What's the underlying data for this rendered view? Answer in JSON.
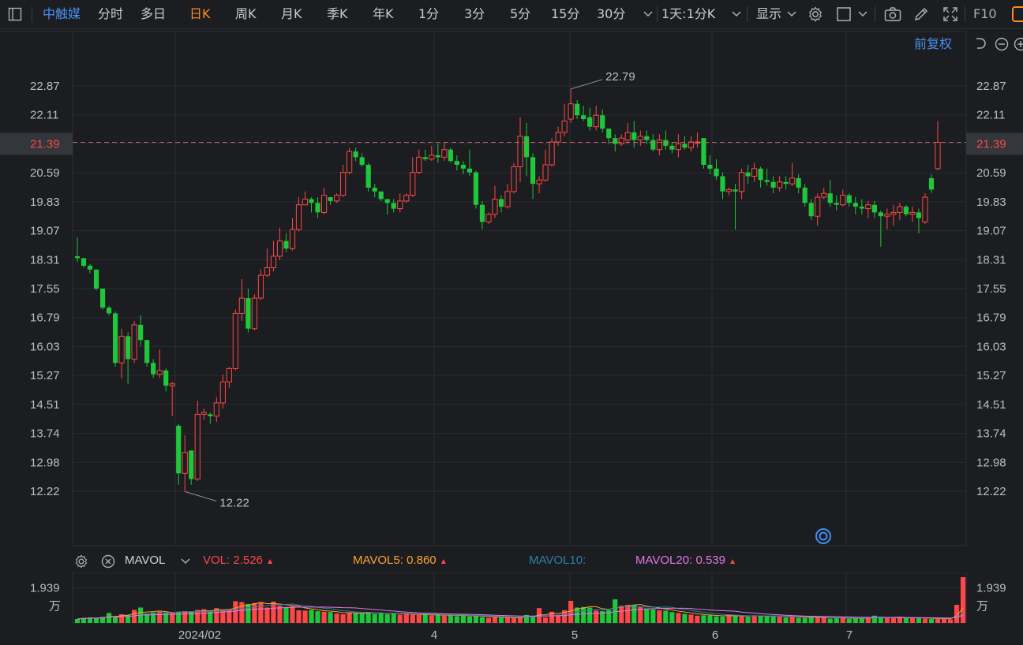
{
  "toolbar": {
    "stock_name": "中触媒",
    "periods": [
      "分时",
      "多日",
      "日K",
      "周K",
      "月K",
      "季K",
      "年K",
      "1分",
      "3分",
      "5分",
      "15分",
      "30分"
    ],
    "active_period": "日K",
    "combo_label": "1天:1分K",
    "display_label": "显示",
    "f10_label": "F10",
    "icons": [
      "sidebar-toggle-icon",
      "chevron-down-icon",
      "gear-icon",
      "square-icon",
      "camera-icon",
      "pencil-icon",
      "fullscreen-icon"
    ]
  },
  "sub_toolbar": {
    "adjust_label": "前复权"
  },
  "colors": {
    "up": "#ff4747",
    "down": "#1fc73a",
    "ma5": "#ffa133",
    "ma10": "#2f7fa8",
    "ma20": "#e278e6",
    "price_line": "#c46565",
    "accent": "#4a90f0"
  },
  "chart_data": [
    {
      "type": "candlestick",
      "y_ticks": [
        "22.87",
        "22.11",
        "21.39",
        "20.59",
        "19.83",
        "19.07",
        "18.31",
        "17.55",
        "16.79",
        "16.03",
        "15.27",
        "14.51",
        "13.74",
        "12.98",
        "12.22"
      ],
      "current_price": "21.39",
      "high_label": "22.79",
      "low_label": "12.22",
      "ylim": [
        11.5,
        23.6
      ],
      "candles": [
        [
          18.4,
          18.35,
          18.9,
          18.25
        ],
        [
          18.35,
          18.15,
          18.35,
          18.1
        ],
        [
          18.15,
          18.05,
          18.2,
          17.95
        ],
        [
          18.05,
          17.55,
          18.05,
          17.5
        ],
        [
          17.55,
          17.05,
          17.55,
          17.0
        ],
        [
          17.05,
          16.9,
          17.1,
          16.85
        ],
        [
          16.9,
          15.6,
          16.95,
          15.5
        ],
        [
          15.6,
          16.3,
          16.5,
          15.2
        ],
        [
          16.3,
          15.7,
          16.4,
          15.05
        ],
        [
          15.7,
          16.6,
          16.7,
          15.6
        ],
        [
          16.6,
          16.2,
          16.85,
          16.05
        ],
        [
          16.2,
          15.6,
          16.2,
          15.5
        ],
        [
          15.6,
          15.3,
          15.7,
          15.2
        ],
        [
          15.3,
          15.4,
          15.95,
          15.2
        ],
        [
          15.4,
          15.0,
          15.45,
          14.85
        ],
        [
          15.0,
          15.05,
          15.1,
          14.2
        ],
        [
          13.95,
          12.7,
          14.0,
          12.4
        ],
        [
          12.7,
          13.25,
          13.7,
          12.22
        ],
        [
          13.3,
          12.55,
          13.3,
          12.4
        ],
        [
          12.55,
          14.25,
          14.6,
          12.5
        ],
        [
          14.25,
          14.3,
          14.4,
          14.1
        ],
        [
          14.25,
          14.2,
          14.3,
          14.0
        ],
        [
          14.2,
          14.55,
          14.7,
          14.05
        ],
        [
          14.55,
          15.1,
          15.3,
          14.4
        ],
        [
          15.1,
          15.45,
          15.5,
          14.95
        ],
        [
          15.45,
          16.9,
          17.0,
          15.4
        ],
        [
          16.9,
          17.3,
          17.8,
          16.7
        ],
        [
          17.3,
          16.5,
          17.55,
          16.4
        ],
        [
          16.5,
          17.3,
          17.4,
          16.45
        ],
        [
          17.3,
          17.9,
          18.05,
          17.25
        ],
        [
          17.9,
          18.1,
          18.6,
          17.85
        ],
        [
          18.1,
          18.4,
          18.8,
          18.0
        ],
        [
          18.4,
          18.8,
          19.15,
          18.3
        ],
        [
          18.8,
          18.6,
          19.0,
          18.5
        ],
        [
          18.6,
          19.1,
          19.4,
          18.55
        ],
        [
          19.1,
          19.75,
          19.95,
          19.05
        ],
        [
          19.75,
          19.9,
          20.1,
          19.75
        ],
        [
          19.9,
          19.8,
          19.95,
          19.55
        ],
        [
          19.8,
          19.55,
          19.95,
          19.4
        ],
        [
          19.55,
          20.0,
          20.2,
          19.5
        ],
        [
          19.95,
          19.85,
          19.95,
          19.75
        ],
        [
          19.85,
          20.0,
          20.05,
          19.8
        ],
        [
          20.0,
          20.6,
          20.8,
          19.95
        ],
        [
          20.6,
          21.15,
          21.25,
          20.55
        ],
        [
          21.15,
          21.0,
          21.25,
          20.9
        ],
        [
          21.0,
          20.8,
          21.1,
          20.75
        ],
        [
          20.8,
          20.2,
          20.85,
          20.1
        ],
        [
          20.2,
          20.1,
          20.3,
          19.95
        ],
        [
          20.1,
          19.9,
          20.1,
          19.85
        ],
        [
          19.9,
          19.8,
          19.9,
          19.5
        ],
        [
          19.8,
          19.65,
          19.9,
          19.55
        ],
        [
          19.65,
          19.85,
          20.05,
          19.55
        ],
        [
          19.85,
          20.0,
          20.05,
          19.8
        ],
        [
          20.0,
          20.6,
          21.0,
          19.95
        ],
        [
          20.6,
          21.0,
          21.2,
          20.55
        ],
        [
          21.0,
          20.95,
          21.2,
          20.9
        ],
        [
          20.95,
          21.05,
          21.3,
          20.9
        ],
        [
          21.05,
          21.0,
          21.35,
          20.85
        ],
        [
          21.0,
          21.2,
          21.4,
          20.9
        ],
        [
          21.2,
          20.9,
          21.25,
          20.85
        ],
        [
          20.9,
          20.8,
          21.05,
          20.65
        ],
        [
          20.8,
          20.7,
          20.9,
          20.55
        ],
        [
          20.7,
          20.6,
          21.2,
          20.5
        ],
        [
          20.6,
          19.75,
          20.65,
          19.65
        ],
        [
          19.75,
          19.3,
          19.85,
          19.1
        ],
        [
          19.3,
          19.5,
          19.55,
          19.25
        ],
        [
          19.5,
          19.9,
          20.25,
          19.4
        ],
        [
          19.9,
          19.7,
          20.0,
          19.55
        ],
        [
          19.7,
          20.1,
          20.3,
          19.65
        ],
        [
          20.1,
          20.75,
          20.85,
          20.05
        ],
        [
          20.75,
          21.55,
          22.05,
          20.35
        ],
        [
          21.55,
          21.0,
          21.9,
          20.5
        ],
        [
          21.0,
          20.3,
          21.1,
          19.9
        ],
        [
          20.3,
          20.4,
          20.5,
          20.05
        ],
        [
          20.4,
          20.8,
          21.2,
          20.35
        ],
        [
          20.8,
          21.4,
          21.5,
          20.75
        ],
        [
          21.4,
          21.65,
          21.8,
          21.3
        ],
        [
          21.65,
          21.95,
          22.4,
          21.55
        ],
        [
          22.0,
          22.4,
          22.79,
          21.9
        ],
        [
          22.4,
          22.1,
          22.5,
          22.0
        ],
        [
          22.1,
          22.0,
          22.35,
          21.95
        ],
        [
          22.05,
          21.8,
          22.3,
          21.7
        ],
        [
          21.8,
          22.1,
          22.35,
          21.7
        ],
        [
          22.1,
          21.75,
          22.25,
          21.65
        ],
        [
          21.75,
          21.5,
          21.75,
          21.35
        ],
        [
          21.5,
          21.35,
          21.6,
          21.15
        ],
        [
          21.35,
          21.5,
          21.6,
          21.3
        ],
        [
          21.45,
          21.65,
          21.9,
          21.35
        ],
        [
          21.65,
          21.45,
          21.95,
          21.25
        ],
        [
          21.45,
          21.55,
          21.7,
          21.3
        ],
        [
          21.55,
          21.45,
          21.7,
          21.35
        ],
        [
          21.45,
          21.2,
          21.6,
          21.15
        ],
        [
          21.2,
          21.45,
          21.6,
          21.05
        ],
        [
          21.45,
          21.3,
          21.7,
          21.2
        ],
        [
          21.3,
          21.2,
          21.4,
          21.1
        ],
        [
          21.2,
          21.35,
          21.6,
          21.0
        ],
        [
          21.35,
          21.25,
          21.55,
          21.2
        ],
        [
          21.25,
          21.4,
          21.55,
          21.15
        ],
        [
          21.4,
          21.4,
          21.65,
          21.25
        ],
        [
          21.5,
          20.8,
          21.5,
          20.7
        ],
        [
          20.8,
          20.7,
          21.05,
          20.55
        ],
        [
          20.7,
          20.5,
          20.95,
          20.4
        ],
        [
          20.5,
          20.1,
          20.6,
          19.9
        ],
        [
          20.1,
          20.15,
          20.2,
          20.0
        ],
        [
          20.15,
          20.1,
          20.3,
          19.1
        ],
        [
          20.1,
          20.6,
          20.7,
          19.9
        ],
        [
          20.6,
          20.5,
          20.8,
          20.3
        ],
        [
          20.5,
          20.7,
          20.85,
          20.35
        ],
        [
          20.7,
          20.4,
          20.75,
          20.2
        ],
        [
          20.4,
          20.35,
          20.7,
          20.25
        ],
        [
          20.35,
          20.2,
          20.5,
          20.05
        ],
        [
          20.2,
          20.35,
          20.5,
          20.1
        ],
        [
          20.35,
          20.3,
          20.5,
          20.15
        ],
        [
          20.3,
          20.45,
          20.85,
          20.25
        ],
        [
          20.45,
          20.2,
          20.55,
          20.05
        ],
        [
          20.2,
          19.8,
          20.3,
          19.7
        ],
        [
          19.8,
          19.45,
          19.9,
          19.35
        ],
        [
          19.45,
          19.95,
          20.05,
          19.2
        ],
        [
          19.95,
          20.05,
          20.2,
          19.9
        ],
        [
          20.05,
          19.8,
          20.4,
          19.7
        ],
        [
          19.8,
          19.75,
          20.0,
          19.6
        ],
        [
          19.75,
          20.0,
          20.15,
          19.7
        ],
        [
          20.0,
          19.8,
          20.05,
          19.7
        ],
        [
          19.8,
          19.7,
          19.95,
          19.5
        ],
        [
          19.7,
          19.65,
          19.9,
          19.5
        ],
        [
          19.65,
          19.75,
          19.85,
          19.4
        ],
        [
          19.75,
          19.55,
          19.85,
          19.4
        ],
        [
          19.55,
          19.45,
          19.6,
          18.65
        ],
        [
          19.45,
          19.5,
          19.65,
          19.1
        ],
        [
          19.5,
          19.55,
          19.75,
          19.2
        ],
        [
          19.55,
          19.7,
          19.8,
          19.35
        ],
        [
          19.7,
          19.5,
          19.75,
          19.45
        ],
        [
          19.5,
          19.55,
          19.7,
          19.3
        ],
        [
          19.55,
          19.4,
          19.65,
          19.0
        ],
        [
          19.3,
          19.95,
          20.05,
          19.25
        ],
        [
          20.45,
          20.15,
          20.55,
          20.05
        ],
        [
          20.7,
          21.39,
          21.95,
          20.65
        ]
      ],
      "x_labels": [
        "2024/02",
        "4",
        "5",
        "6",
        "7"
      ]
    },
    {
      "type": "bar",
      "name": "MAVOL",
      "y_tick": "1.939",
      "unit_label": "万",
      "vols": [
        0.22,
        0.28,
        0.3,
        0.26,
        0.33,
        0.55,
        0.35,
        0.48,
        0.45,
        0.72,
        0.85,
        0.52,
        0.58,
        0.62,
        0.55,
        0.58,
        0.62,
        0.65,
        0.58,
        0.72,
        0.76,
        0.65,
        0.82,
        0.7,
        0.75,
        1.2,
        1.15,
        1.05,
        1.1,
        1.15,
        0.85,
        1.18,
        0.95,
        0.88,
        0.92,
        0.7,
        0.68,
        0.72,
        0.65,
        0.62,
        0.6,
        0.52,
        0.48,
        0.58,
        0.56,
        0.52,
        0.6,
        0.5,
        0.55,
        0.48,
        0.52,
        0.45,
        0.5,
        0.45,
        0.44,
        0.46,
        0.42,
        0.44,
        0.4,
        0.42,
        0.38,
        0.42,
        0.36,
        0.4,
        0.32,
        0.28,
        0.32,
        0.3,
        0.28,
        0.26,
        0.3,
        0.44,
        0.4,
        0.82,
        0.3,
        0.62,
        0.45,
        0.7,
        1.22,
        0.85,
        0.88,
        0.85,
        0.68,
        0.65,
        0.72,
        1.3,
        0.95,
        1.0,
        0.98,
        0.88,
        0.8,
        0.75,
        0.7,
        0.68,
        0.6,
        0.55,
        0.5,
        0.46,
        0.4,
        0.42,
        0.42,
        0.36,
        0.35,
        0.46,
        0.4,
        0.36,
        0.34,
        0.42,
        0.38,
        0.36,
        0.4,
        0.34,
        0.3,
        0.34,
        0.28,
        0.26,
        0.36,
        0.32,
        0.28,
        0.24,
        0.26,
        0.3,
        0.22,
        0.28,
        0.26,
        0.24,
        0.4,
        0.34,
        0.28,
        0.26,
        0.32,
        0.3,
        0.28,
        0.26,
        0.24,
        0.22,
        0.22,
        0.26,
        0.2,
        1.0,
        2.526
      ]
    }
  ],
  "indicator": {
    "name": "MAVOL",
    "vol_label": "VOL:",
    "vol_value": "2.526",
    "mavol5_label": "MAVOL5:",
    "mavol5_value": "0.860",
    "mavol10_label": "MAVOL10:",
    "mavol10_value": "",
    "mavol20_label": "MAVOL20:",
    "mavol20_value": "0.539"
  }
}
